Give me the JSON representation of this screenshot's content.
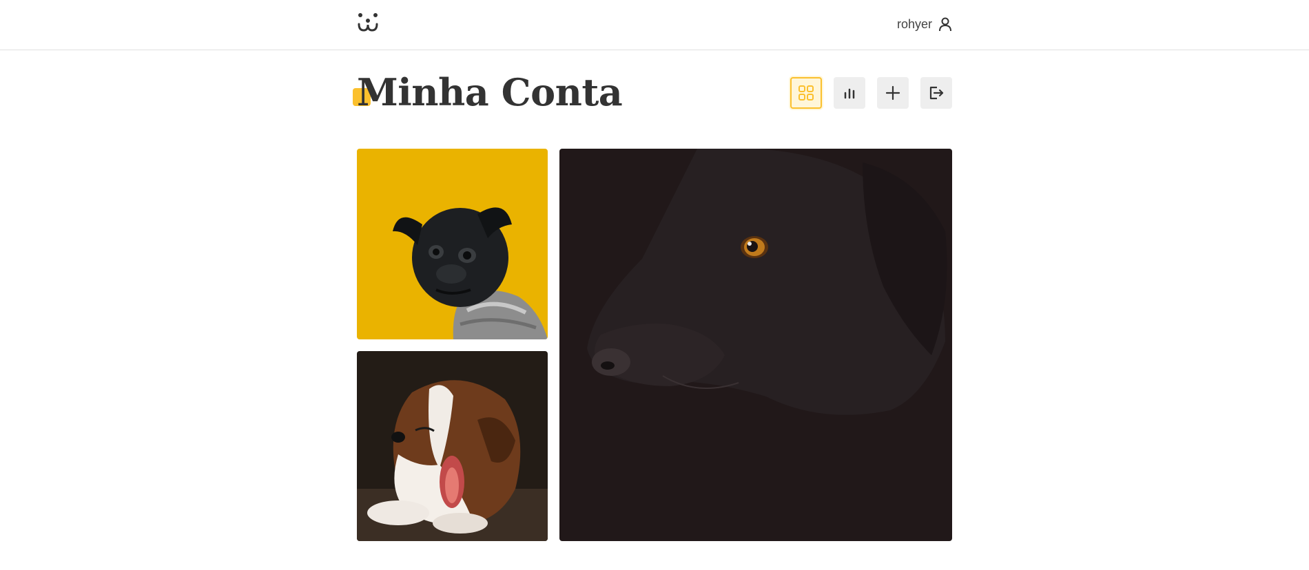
{
  "header": {
    "logo_icon": "dog-face-icon",
    "username": "rohyer",
    "user_icon": "user-icon"
  },
  "page": {
    "title": "Minha Conta"
  },
  "toolbar": [
    {
      "name": "feed-grid-button",
      "icon": "grid-icon",
      "active": true
    },
    {
      "name": "stats-button",
      "icon": "bar-chart-icon",
      "active": false
    },
    {
      "name": "add-photo-button",
      "icon": "plus-icon",
      "active": false
    },
    {
      "name": "logout-button",
      "icon": "logout-icon",
      "active": false
    }
  ],
  "photos": [
    {
      "name": "photo-pug-yellow"
    },
    {
      "name": "photo-puppy-yawning"
    },
    {
      "name": "photo-black-dog"
    }
  ],
  "colors": {
    "accent": "#fbc02d",
    "button_bg": "#eeeeee",
    "text": "#333333"
  }
}
